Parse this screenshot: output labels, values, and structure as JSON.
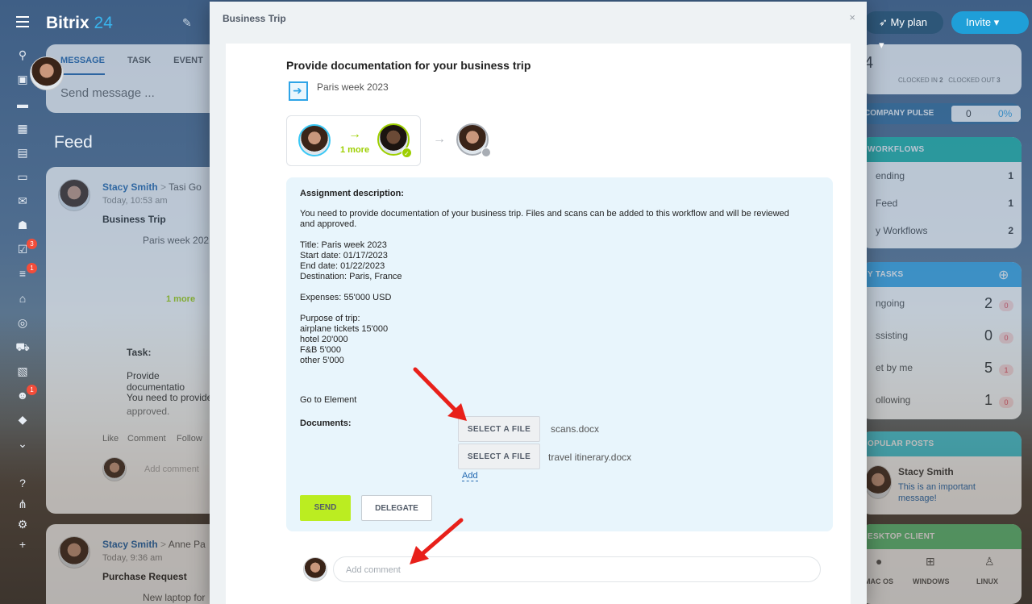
{
  "app": {
    "brand_name": "Bitrix",
    "brand_number": "24"
  },
  "leftbar": {
    "badges": [
      "3",
      "1",
      "1"
    ]
  },
  "composer": {
    "tabs": [
      "MESSAGE",
      "TASK",
      "EVENT"
    ],
    "placeholder": "Send message ..."
  },
  "feed": {
    "title": "Feed",
    "post1": {
      "author": "Stacy Smith",
      "recipient": "Tasi Go",
      "time": "Today, 10:53 am",
      "title": "Business Trip",
      "document": "Paris week 202",
      "more": "1 more",
      "task_label": "Task:",
      "task_text1": "Provide documentatio",
      "task_text2": "You need to provide",
      "task_text3": "approved.",
      "actions": [
        "Like",
        "Comment",
        "Follow"
      ],
      "comment_placeholder": "Add comment"
    },
    "post2": {
      "author": "Stacy Smith",
      "recipient": "Anne Pa",
      "time": "Today, 9:36 am",
      "title": "Purchase Request",
      "document": "New laptop for"
    }
  },
  "rightcol": {
    "my_plan": "My plan",
    "invite": "Invite",
    "clock_count": "4",
    "clocked_in_label": "CLOCKED IN",
    "clocked_in": "2",
    "clocked_out_label": "CLOCKED OUT",
    "clocked_out": "3",
    "pulse_label": "COMPANY PULSE",
    "pulse_value": "0",
    "pulse_percent": "0%",
    "workflows_title": "WORKFLOWS",
    "workflows": [
      {
        "label": "ending",
        "value": "1"
      },
      {
        "label": "Feed",
        "value": "1"
      },
      {
        "label": "y Workflows",
        "value": "2"
      }
    ],
    "tasks_title": "Y TASKS",
    "tasks": [
      {
        "label": "ngoing",
        "value": "2",
        "pill": "0"
      },
      {
        "label": "ssisting",
        "value": "0",
        "pill": "0"
      },
      {
        "label": "et by me",
        "value": "5",
        "pill": "1"
      },
      {
        "label": "ollowing",
        "value": "1",
        "pill": "0"
      }
    ],
    "popular_title": "OPULAR POSTS",
    "popular_author": "Stacy Smith",
    "popular_text": "This is an important message!",
    "desktop_title": "ESKTOP CLIENT",
    "desktop_clients": [
      "MAC OS",
      "WINDOWS",
      "LINUX"
    ]
  },
  "modal": {
    "title": "Business Trip",
    "close": "×",
    "heading": "Provide documentation for your business trip",
    "document_name": "Paris week 2023",
    "flow_more": "1 more",
    "assignment_label": "Assignment description:",
    "description_line1": "You need to provide documentation of your business trip. Files and scans can be added to this workflow and will be reviewed",
    "description_line2": "and approved.",
    "details": [
      "Title: Paris week 2023",
      "Start date: 01/17/2023",
      "End date: 01/22/2023",
      "Destination: Paris, France"
    ],
    "expenses": "Expenses: 55'000 USD",
    "purpose_title": "Purpose of trip:",
    "purpose_items": [
      "airplane tickets 15'000",
      "hotel 20'000",
      "F&B 5'000",
      "other 5'000"
    ],
    "go_to_element": "Go to Element",
    "documents_label": "Documents:",
    "select_file_label": "SELECT A FILE",
    "file1": "scans.docx",
    "file2": "travel itinerary.docx",
    "add_link": "Add",
    "send_label": "SEND",
    "delegate_label": "DELEGATE",
    "comment_placeholder": "Add comment"
  },
  "colors": {
    "accent_blue": "#2067b0",
    "send_green": "#bbed21",
    "flow_green": "#9dcf00",
    "assign_bg": "#e8f5fc",
    "annotation_red": "#e8201a"
  }
}
